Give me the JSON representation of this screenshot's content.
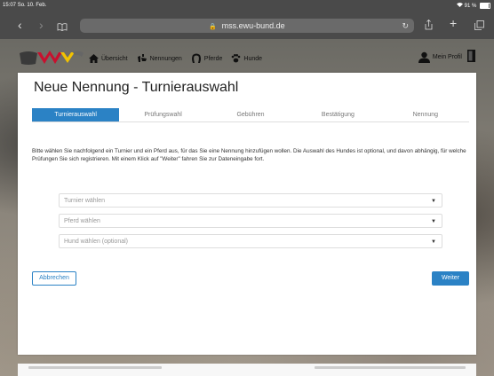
{
  "statusbar": {
    "time": "15:07",
    "date": "So. 10. Feb.",
    "battery": "91 %"
  },
  "browser": {
    "url": "mss.ewu-bund.de"
  },
  "topnav": {
    "items": [
      {
        "label": "Übersicht",
        "icon": "home-icon"
      },
      {
        "label": "Nennungen",
        "icon": "rider-icon"
      },
      {
        "label": "Pferde",
        "icon": "horseshoe-icon"
      },
      {
        "label": "Hunde",
        "icon": "paw-icon"
      }
    ],
    "profile_label": "Mein Profil"
  },
  "page": {
    "title": "Neue Nennung - Turnierauswahl",
    "steps": [
      "Turnierauswahl",
      "Prüfungswahl",
      "Gebühren",
      "Bestätigung",
      "Nennung"
    ],
    "intro": "Bitte wählen Sie nachfolgend ein Turnier und ein Pferd aus, für das Sie eine Nennung hinzufügen wollen. Die Auswahl des Hundes ist optional, und davon abhängig, für welche Prüfungen Sie sich registrieren. Mit einem Klick auf \"Weiter\" fahren Sie zur Dateneingabe fort.",
    "selects": {
      "turnier": "Turnier wählen",
      "pferd": "Pferd wählen",
      "hund": "Hund wählen (optional)"
    },
    "cancel_label": "Abbrechen",
    "next_label": "Weiter"
  },
  "colors": {
    "accent": "#2b82c5",
    "logo_red": "#c8102e",
    "logo_yellow": "#f2c200"
  }
}
